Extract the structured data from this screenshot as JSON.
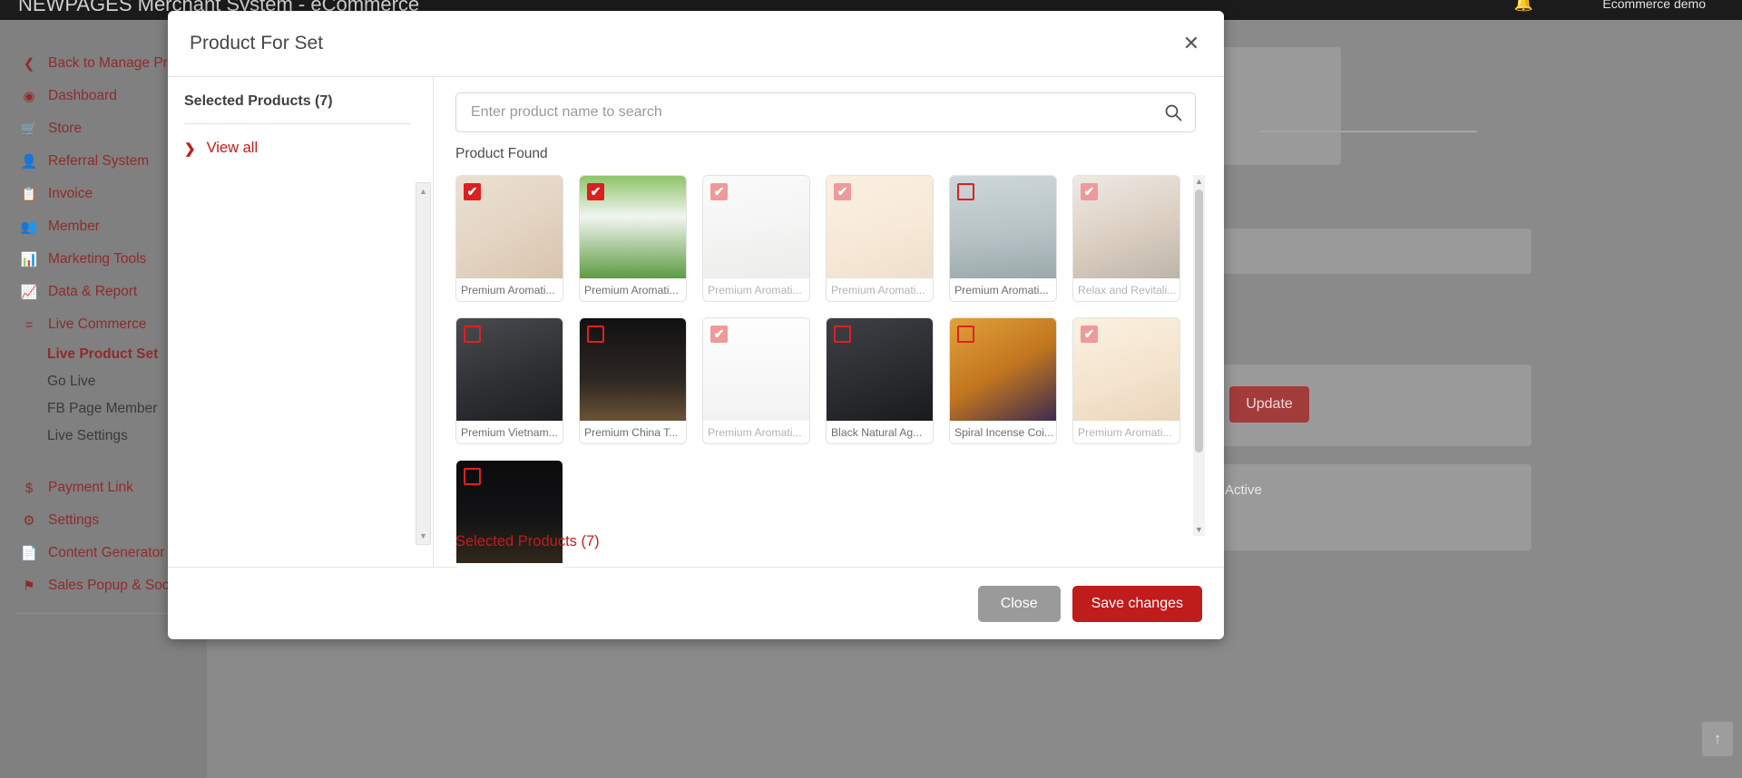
{
  "app": {
    "brand": "NEWPAGES Merchant System - eCommerce",
    "demo_label": "Ecommerce demo",
    "bell_icon": "bell-icon",
    "update_button": "Update",
    "status_label": "Active",
    "scroll_top_icon": "chevron-up-icon"
  },
  "sidebar": {
    "back_label": "Back to Manage Product",
    "back_icon": "chevron-left-icon",
    "items": [
      {
        "label": "Dashboard",
        "icon": "dashboard-icon",
        "glyph": "◑"
      },
      {
        "label": "Store",
        "icon": "cart-icon",
        "glyph": "🛒"
      },
      {
        "label": "Referral System",
        "icon": "user-icon",
        "glyph": "👤"
      },
      {
        "label": "Invoice",
        "icon": "invoice-icon",
        "glyph": "🧾"
      },
      {
        "label": "Member",
        "icon": "members-icon",
        "glyph": "👥"
      },
      {
        "label": "Marketing Tools",
        "icon": "bar-chart-icon",
        "glyph": "📊"
      },
      {
        "label": "Data & Report",
        "icon": "area-chart-icon",
        "glyph": "📈"
      },
      {
        "label": "Live Commerce",
        "icon": "facebook-icon",
        "glyph": "f"
      }
    ],
    "sub_items": [
      {
        "label": "Live Product Set",
        "active": true
      },
      {
        "label": "Go Live",
        "active": false
      },
      {
        "label": "FB Page Member",
        "active": false
      },
      {
        "label": "Live Settings",
        "active": false
      }
    ],
    "bottom_items": [
      {
        "label": "Payment Link",
        "icon": "dollar-icon",
        "glyph": "$"
      },
      {
        "label": "Settings",
        "icon": "gear-icon",
        "glyph": "⚙"
      },
      {
        "label": "Content Generator",
        "icon": "document-icon",
        "glyph": "📄"
      },
      {
        "label": "Sales Popup & Social Pr",
        "icon": "flag-icon",
        "glyph": "⚑"
      }
    ]
  },
  "modal": {
    "title": "Product For Set",
    "close_icon": "close-icon",
    "left": {
      "selected_heading": "Selected Products (7)",
      "view_all_label": "View all",
      "view_all_icon": "chevron-right-icon",
      "scroll_up_icon": "scroll-up-arrow",
      "scroll_down_icon": "scroll-down-arrow"
    },
    "search": {
      "placeholder": "Enter product name to search",
      "value": "",
      "icon": "search-icon"
    },
    "product_found_label": "Product Found",
    "bottom_selected_label": "Selected Products (7)",
    "grid_scroll_up_icon": "scroll-up-arrow",
    "grid_scroll_down_icon": "scroll-down-arrow",
    "products": [
      {
        "name": "Premium Aromati...",
        "checked": true,
        "muted": false,
        "art": "a1"
      },
      {
        "name": "Premium Aromati...",
        "checked": true,
        "muted": false,
        "art": "a2"
      },
      {
        "name": "Premium Aromati...",
        "checked": true,
        "muted": true,
        "art": "a3"
      },
      {
        "name": "Premium Aromati...",
        "checked": true,
        "muted": true,
        "art": "a4"
      },
      {
        "name": "Premium Aromati...",
        "checked": false,
        "muted": false,
        "art": "a5"
      },
      {
        "name": "Relax and Revitali...",
        "checked": true,
        "muted": true,
        "art": "a6"
      },
      {
        "name": "Premium Vietnam...",
        "checked": false,
        "muted": false,
        "art": "b1"
      },
      {
        "name": "Premium China T...",
        "checked": false,
        "muted": false,
        "art": "b2"
      },
      {
        "name": "Premium Aromati...",
        "checked": true,
        "muted": true,
        "art": "b3"
      },
      {
        "name": "Black Natural Ag...",
        "checked": false,
        "muted": false,
        "art": "b4"
      },
      {
        "name": "Spiral Incense Coi...",
        "checked": false,
        "muted": false,
        "art": "b5"
      },
      {
        "name": "Premium Aromati...",
        "checked": true,
        "muted": true,
        "art": "b6"
      },
      {
        "name": "",
        "checked": false,
        "muted": false,
        "art": "c1"
      }
    ],
    "footer": {
      "close_label": "Close",
      "save_label": "Save changes"
    }
  },
  "colors": {
    "accent_red": "#c01c1c",
    "checkbox_red": "#dc1f1f",
    "sidebar_link": "#8f2b2b",
    "sidebar_bg": "#808080"
  }
}
